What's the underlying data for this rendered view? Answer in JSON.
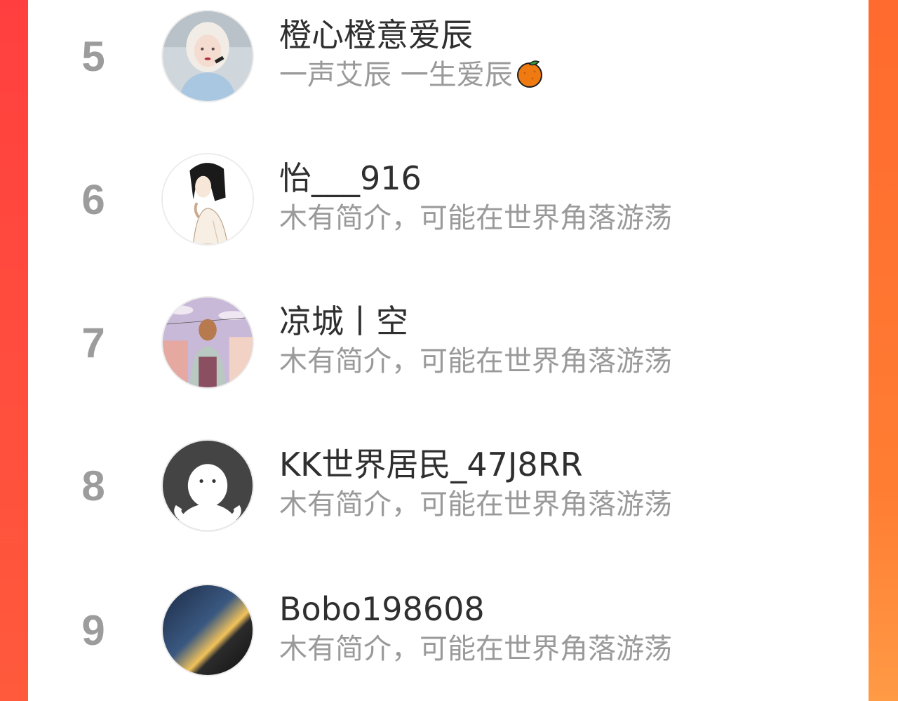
{
  "leaderboard": {
    "rows": [
      {
        "rank": "5",
        "name": "橙心橙意爱辰",
        "bio": "一声艾辰 一生爱辰",
        "bio_icon": "orange-fruit-icon"
      },
      {
        "rank": "6",
        "name": "怡___916",
        "bio": "木有简介，可能在世界角落游荡"
      },
      {
        "rank": "7",
        "name": "凉城丨空",
        "bio": "木有简介，可能在世界角落游荡"
      },
      {
        "rank": "8",
        "name": "KK世界居民_47J8RR",
        "bio": "木有简介，可能在世界角落游荡"
      },
      {
        "rank": "9",
        "name": "Bobo198608",
        "bio": "木有简介，可能在世界角落游荡"
      }
    ]
  },
  "colors": {
    "background_accent": "#ff5a3c",
    "panel": "#ffffff",
    "rank": "#9c9c9c",
    "name": "#2f2f2f",
    "bio": "#9a9a9a"
  }
}
